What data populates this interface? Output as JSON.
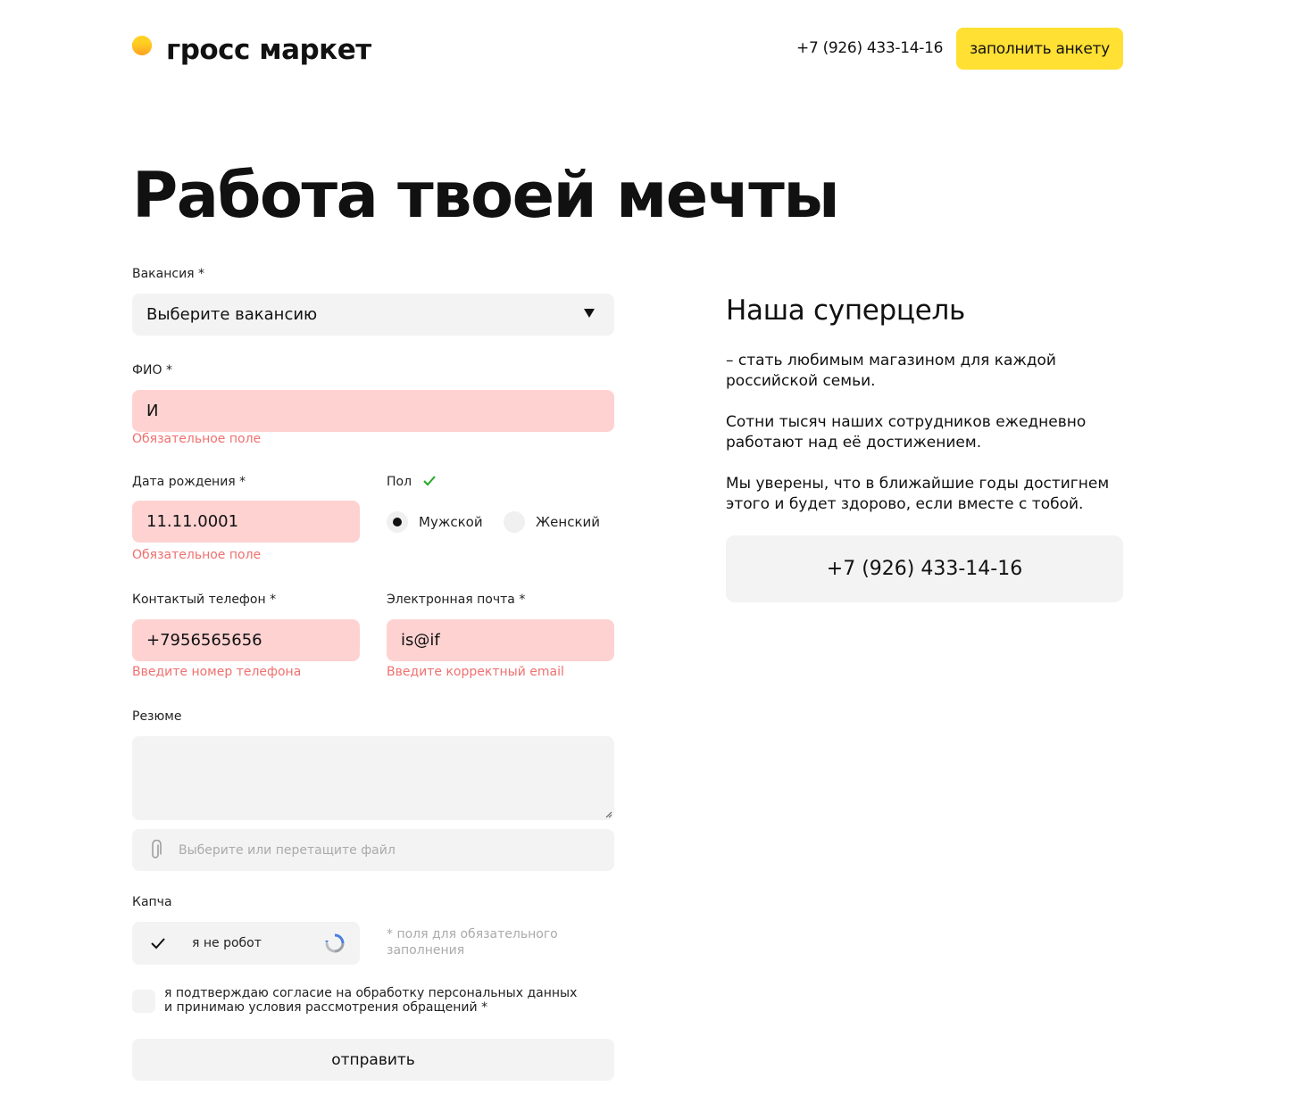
{
  "header": {
    "logo_text": "гросс маркет",
    "phone": "+7 (926) 433-14-16",
    "cta_label": "заполнить анкету"
  },
  "page_title": "Работа твоей мечты",
  "form": {
    "vacancy": {
      "label": "Вакансия *",
      "value": "Выберите вакансию"
    },
    "fio": {
      "label": "ФИО *",
      "value": "И",
      "error": "Обязательное поле"
    },
    "birthdate": {
      "label": "Дата рождения *",
      "value": "11.11.0001",
      "error": "Обязательное поле"
    },
    "gender": {
      "label": "Пол",
      "options": [
        "Мужской",
        "Женский"
      ],
      "selected": "Мужской"
    },
    "phone": {
      "label": "Контактый телефон *",
      "value": "+7956565656",
      "error": "Введите номер телефона"
    },
    "email": {
      "label": "Электронная почта *",
      "value": "is@if",
      "error": "Введите корректный email"
    },
    "resume": {
      "label": "Резюме",
      "value": ""
    },
    "file": {
      "placeholder": "Выберите или перетащите файл"
    },
    "captcha": {
      "label": "Капча",
      "text": "я не робот"
    },
    "required_note": "* поля для обязательного заполнения",
    "consent": "я подтверждаю согласие на обработку персональных данных и принимаю условия рассмотрения обращений *",
    "submit_label": "отправить"
  },
  "aside": {
    "title": "Наша суперцель",
    "paragraphs": [
      "– стать любимым магазином для каждой российской семьи.",
      "Сотни тысяч наших сотрудников ежедневно работают над её достижением.",
      "Мы уверены, что в ближайшие годы достигнем этого и будет здорово, если вместе с тобой."
    ],
    "phone": "+7 (926) 433-14-16"
  },
  "colors": {
    "accent": "#ffe033",
    "error_bg": "#ffd2d2",
    "error_text": "#f07070",
    "field_bg": "#f3f3f3",
    "success": "#22aa22"
  }
}
